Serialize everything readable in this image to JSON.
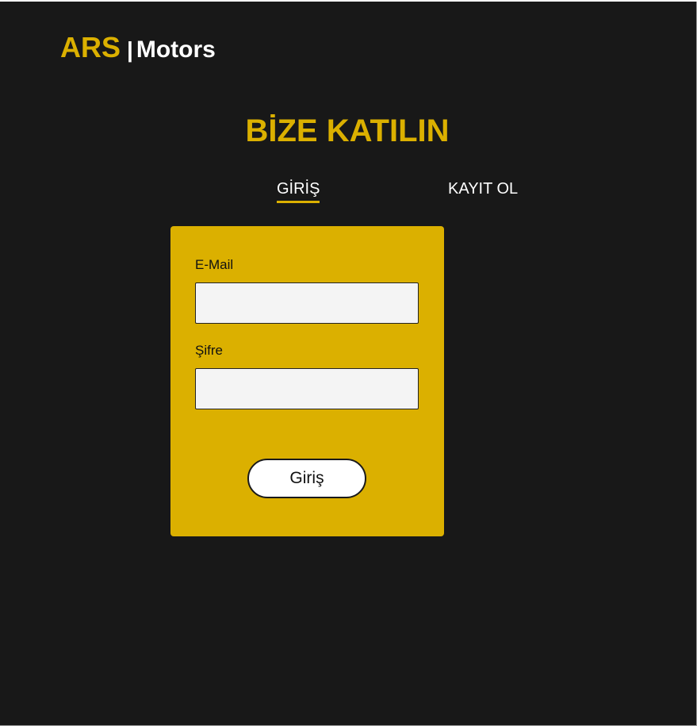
{
  "header": {
    "logo_brand": "ARS",
    "logo_separator": "|",
    "logo_name": "Motors"
  },
  "main": {
    "title": "BİZE KATILIN",
    "tabs": [
      {
        "label": "GİRİŞ",
        "active": true
      },
      {
        "label": "KAYIT OL",
        "active": false
      }
    ]
  },
  "login_form": {
    "email_label": "E-Mail",
    "email_value": "",
    "password_label": "Şifre",
    "password_value": "",
    "submit_label": "Giriş"
  },
  "colors": {
    "background": "#181818",
    "accent": "#dbb000",
    "text_light": "#ffffff",
    "text_dark": "#111111"
  }
}
